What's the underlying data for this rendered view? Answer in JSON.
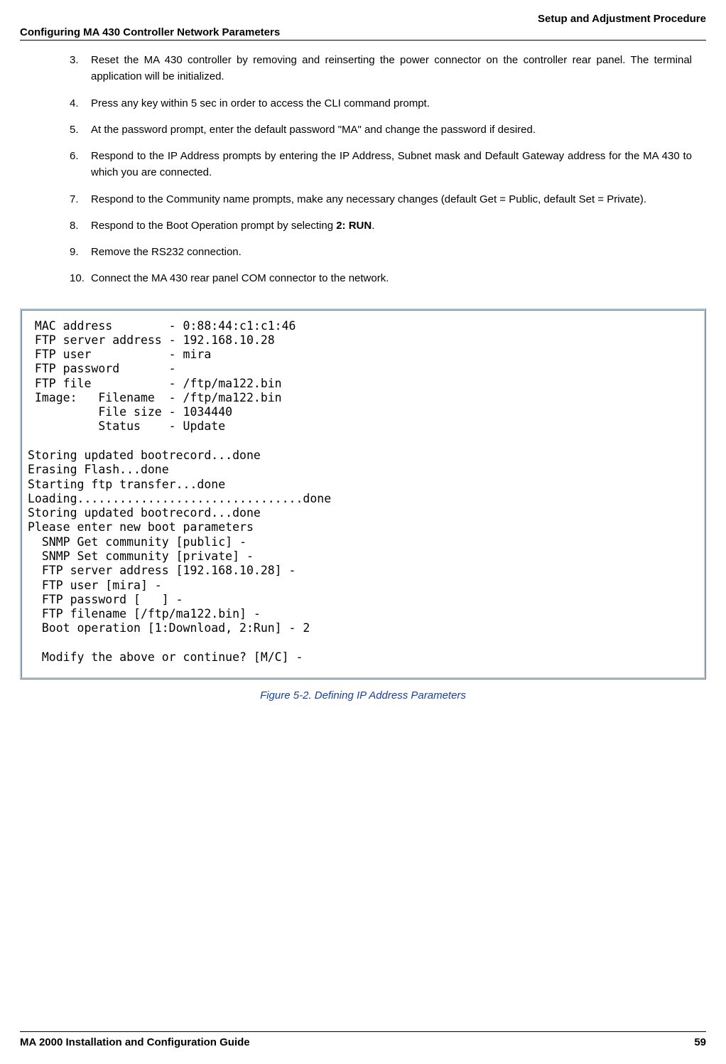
{
  "header": {
    "right": "Setup and Adjustment Procedure",
    "left": "Configuring MA 430 Controller Network Parameters"
  },
  "steps": {
    "s3": "Reset the MA 430 controller by removing and reinserting the power connector on the controller rear panel. The terminal application will be initialized.",
    "s4": "Press any key within 5 sec in order to access the CLI command prompt.",
    "s5": "At the password prompt, enter the default password \"MA\" and change the password if desired.",
    "s6": "Respond to the IP Address prompts by entering the IP Address, Subnet mask and Default Gateway address for the MA 430 to which you are connected.",
    "s7": "Respond to the Community name prompts, make any necessary changes (default Get = Public, default Set = Private).",
    "s8_pre": "Respond to the Boot Operation prompt by selecting ",
    "s8_bold": "2: RUN",
    "s8_post": ".",
    "s9": "Remove the RS232 connection.",
    "s10": "Connect the MA 430 rear panel COM connector to the network."
  },
  "terminal_text": " MAC address        - 0:88:44:c1:c1:46\n FTP server address - 192.168.10.28\n FTP user           - mira\n FTP password       -\n FTP file           - /ftp/ma122.bin\n Image:   Filename  - /ftp/ma122.bin\n          File size - 1034440\n          Status    - Update\n\nStoring updated bootrecord...done\nErasing Flash...done\nStarting ftp transfer...done\nLoading................................done\nStoring updated bootrecord...done\nPlease enter new boot parameters\n  SNMP Get community [public] -\n  SNMP Set community [private] -\n  FTP server address [192.168.10.28] -\n  FTP user [mira] -\n  FTP password [   ] -\n  FTP filename [/ftp/ma122.bin] -\n  Boot operation [1:Download, 2:Run] - 2\n\n  Modify the above or continue? [M/C] -",
  "figure_caption": "Figure 5-2. Defining IP Address Parameters",
  "footer": {
    "left": "MA 2000 Installation and Configuration Guide",
    "right": "59"
  }
}
